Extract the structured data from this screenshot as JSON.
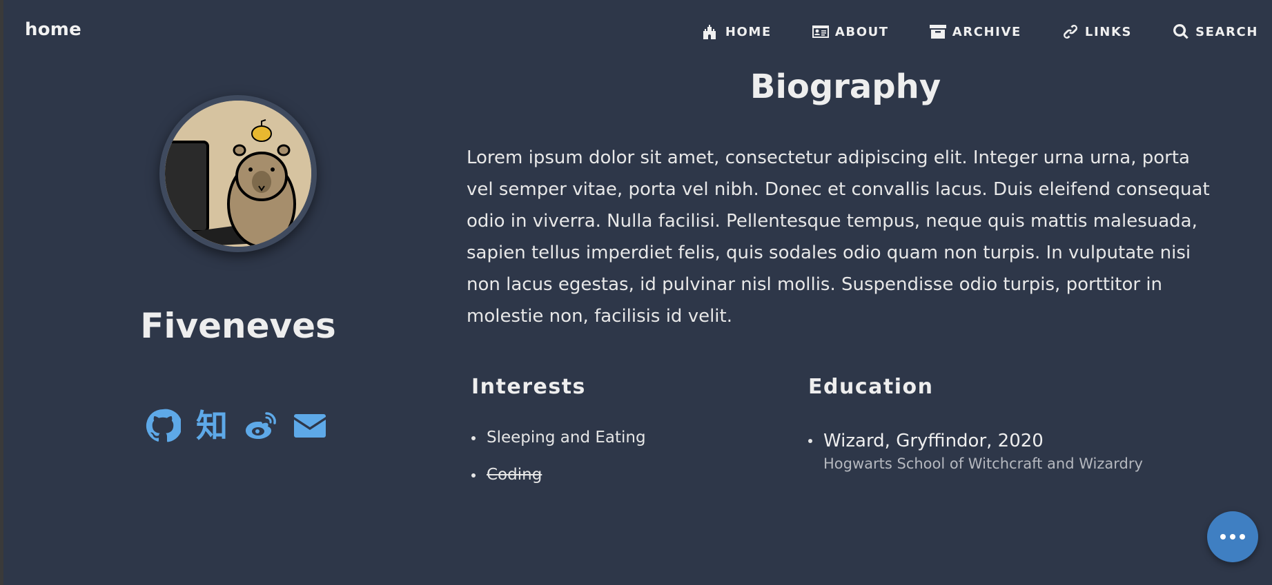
{
  "header": {
    "brand": "home",
    "nav": [
      {
        "label": "HOME",
        "icon": "castle-icon"
      },
      {
        "label": "ABOUT",
        "icon": "id-card-icon"
      },
      {
        "label": "ARCHIVE",
        "icon": "archive-box-icon"
      },
      {
        "label": "LINKS",
        "icon": "link-icon"
      },
      {
        "label": "SEARCH",
        "icon": "search-icon"
      }
    ]
  },
  "profile": {
    "name": "Fiveneves",
    "avatar": "capybara-avatar",
    "socials": [
      {
        "icon": "github-icon"
      },
      {
        "icon": "zhihu-icon",
        "glyph": "知"
      },
      {
        "icon": "weibo-icon"
      },
      {
        "icon": "email-icon"
      }
    ]
  },
  "biography": {
    "title": "Biography",
    "text": "Lorem ipsum dolor sit amet, consectetur adipiscing elit. Integer urna urna, porta vel semper vitae, porta vel nibh. Donec et convallis lacus. Duis eleifend consequat odio in viverra. Nulla facilisi. Pellentesque tempus, neque quis mattis malesuada, sapien tellus imperdiet felis, quis sodales odio quam non turpis. In vulputate nisi non lacus egestas, id pulvinar nisl mollis. Suspendisse odio turpis, porttitor in molestie non, facilisis id velit."
  },
  "interests": {
    "title": "Interests",
    "items": [
      "Sleeping and Eating",
      "Coding"
    ]
  },
  "education": {
    "title": "Education",
    "items": [
      {
        "degree": "Wizard, Gryffindor, 2020",
        "school": "Hogwarts School of Witchcraft and Wizardry"
      }
    ]
  },
  "colors": {
    "background": "#2e3749",
    "accent": "#5ea9e8",
    "fab": "#3f7fc2"
  }
}
